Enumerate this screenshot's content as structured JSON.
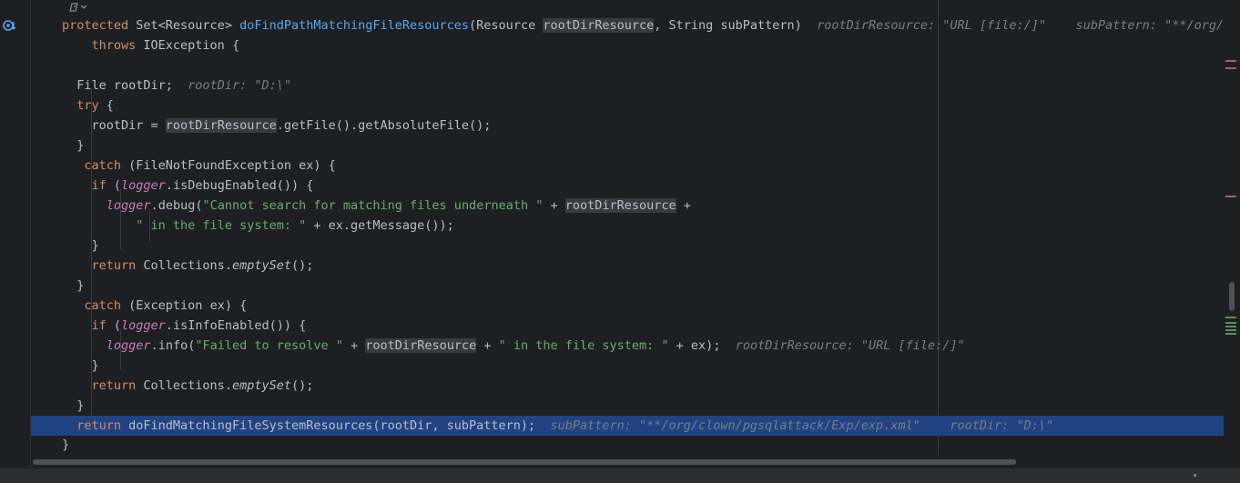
{
  "editor": {
    "lines": [
      [
        {
          "t": "protected",
          "c": "kw"
        },
        {
          "t": " Set<Resource> "
        },
        {
          "t": "doFindPathMatchingFileResources",
          "c": "fn"
        },
        {
          "t": "(Resource "
        },
        {
          "t": "rootDirResource",
          "c": "param-hl"
        },
        {
          "t": ", String subPattern)  "
        },
        {
          "t": "rootDirResource: \"URL [file:/]\"    subPattern: \"**/org/clow",
          "c": "inlay"
        }
      ],
      [
        {
          "t": "    throws",
          "c": "kw"
        },
        {
          "t": " IOException {"
        }
      ],
      [
        {
          "t": ""
        }
      ],
      [
        {
          "t": "  File rootDir;  "
        },
        {
          "t": "rootDir: \"D:\\\"",
          "c": "inlay"
        }
      ],
      [
        {
          "t": "  try",
          "c": "kw"
        },
        {
          "t": " {"
        }
      ],
      [
        {
          "t": "    rootDir = "
        },
        {
          "t": "rootDirResource",
          "c": "param-hl"
        },
        {
          "t": ".getFile().getAbsoluteFile();"
        }
      ],
      [
        {
          "t": "  }"
        }
      ],
      [
        {
          "t": "   catch",
          "c": "kw"
        },
        {
          "t": " (FileNotFoundException ex) {"
        }
      ],
      [
        {
          "t": "    if",
          "c": "kw"
        },
        {
          "t": " ("
        },
        {
          "t": "logger",
          "c": "field"
        },
        {
          "t": ".isDebugEnabled()) {"
        }
      ],
      [
        {
          "t": "      "
        },
        {
          "t": "logger",
          "c": "field"
        },
        {
          "t": ".debug("
        },
        {
          "t": "\"Cannot search for matching files underneath \"",
          "c": "str"
        },
        {
          "t": " + "
        },
        {
          "t": "rootDirResource",
          "c": "param-hl"
        },
        {
          "t": " +"
        }
      ],
      [
        {
          "t": "          "
        },
        {
          "t": "\" in the file system: \"",
          "c": "str"
        },
        {
          "t": " + ex.getMessage());"
        }
      ],
      [
        {
          "t": "    }"
        }
      ],
      [
        {
          "t": "    return",
          "c": "kw"
        },
        {
          "t": " Collections."
        },
        {
          "t": "emptySet",
          "c": "static"
        },
        {
          "t": "();"
        }
      ],
      [
        {
          "t": "  }"
        }
      ],
      [
        {
          "t": "   catch",
          "c": "kw"
        },
        {
          "t": " (Exception ex) {"
        }
      ],
      [
        {
          "t": "    if",
          "c": "kw"
        },
        {
          "t": " ("
        },
        {
          "t": "logger",
          "c": "field"
        },
        {
          "t": ".isInfoEnabled()) {"
        }
      ],
      [
        {
          "t": "      "
        },
        {
          "t": "logger",
          "c": "field"
        },
        {
          "t": ".info("
        },
        {
          "t": "\"Failed to resolve \"",
          "c": "str"
        },
        {
          "t": " + "
        },
        {
          "t": "rootDirResource",
          "c": "param-hl"
        },
        {
          "t": " + "
        },
        {
          "t": "\" in the file system: \"",
          "c": "str"
        },
        {
          "t": " + ex);  "
        },
        {
          "t": "rootDirResource: \"URL [file:/]\"",
          "c": "inlay"
        }
      ],
      [
        {
          "t": "    }"
        }
      ],
      [
        {
          "t": "    return",
          "c": "kw"
        },
        {
          "t": " Collections."
        },
        {
          "t": "emptySet",
          "c": "static"
        },
        {
          "t": "();"
        }
      ],
      [
        {
          "t": "  }"
        }
      ],
      [
        {
          "t": "  return",
          "c": "kw"
        },
        {
          "t": " doFindMatchingFileSystemResources(rootDir, subPattern);  "
        },
        {
          "t": "subPattern: \"**/org/clown/pgsqlattack/Exp/exp.xml\"    rootDir: \"D:\\\"",
          "c": "inlay"
        }
      ],
      [
        {
          "t": "}"
        }
      ]
    ],
    "highlighted_line": 20
  },
  "icons": {
    "gutter": "debug-execution-point-icon",
    "hint": "ai-assistant-hint-icon"
  },
  "colors": {
    "background": "#1e1f22",
    "keyword": "#cf8e6d",
    "function": "#56a8f5",
    "string": "#6aab73",
    "field": "#c77dbb",
    "inlay": "#7a7e85",
    "highlight": "#214283"
  }
}
